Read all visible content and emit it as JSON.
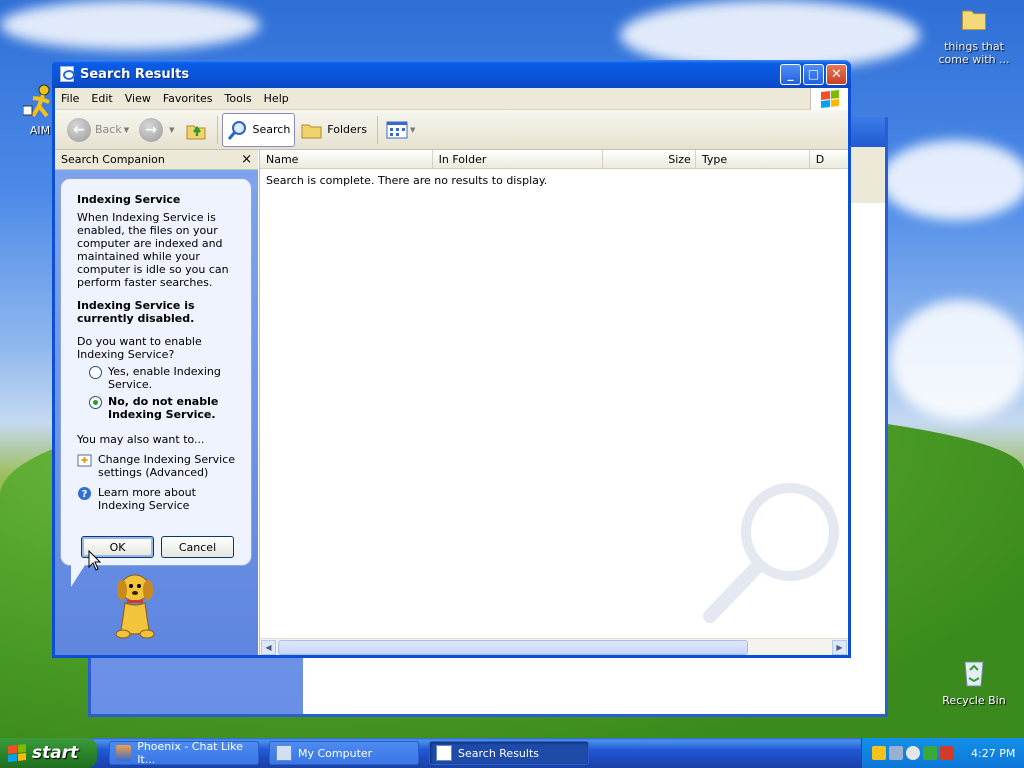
{
  "desktop": {
    "icons": [
      {
        "label": "AIM"
      },
      {
        "label": "things that come with ..."
      },
      {
        "label": "Recycle Bin"
      }
    ]
  },
  "window": {
    "title": "Search Results",
    "menu": [
      "File",
      "Edit",
      "View",
      "Favorites",
      "Tools",
      "Help"
    ],
    "toolbar": {
      "back": "Back",
      "search": "Search",
      "folders": "Folders"
    },
    "companion": {
      "header": "Search Companion",
      "close_glyph": "×",
      "heading": "Indexing Service",
      "intro": "When Indexing Service is enabled, the files on your computer are indexed and maintained while your computer is idle so you can perform faster searches.",
      "status": "Indexing Service is currently disabled.",
      "question": "Do you want to enable Indexing Service?",
      "options": [
        {
          "label": "Yes, enable Indexing Service.",
          "selected": false
        },
        {
          "label": "No, do not enable Indexing Service.",
          "selected": true
        }
      ],
      "also": "You may also want to...",
      "links": [
        {
          "label": "Change Indexing Service settings (Advanced)",
          "icon": "settings-icon"
        },
        {
          "label": "Learn more about Indexing Service",
          "icon": "help-icon"
        }
      ],
      "ok": "OK",
      "cancel": "Cancel"
    },
    "columns": [
      "Name",
      "In Folder",
      "Size",
      "Type",
      "D"
    ],
    "empty_message": "Search is complete. There are no results to display."
  },
  "taskbar": {
    "start": "start",
    "tasks": [
      {
        "label": "Phoenix - Chat Like It...",
        "active": false
      },
      {
        "label": "My Computer",
        "active": false
      },
      {
        "label": "Search Results",
        "active": true
      }
    ],
    "clock": "4:27 PM"
  }
}
